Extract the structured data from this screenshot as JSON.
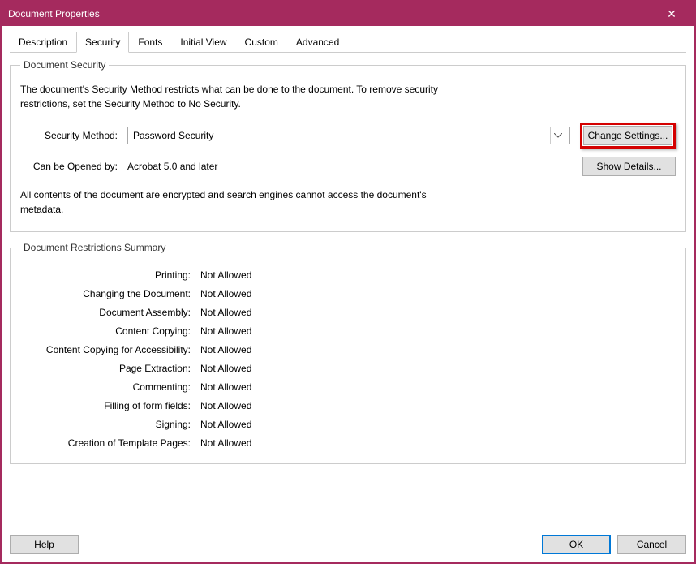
{
  "window": {
    "title": "Document Properties"
  },
  "tabs": {
    "description": "Description",
    "security": "Security",
    "fonts": "Fonts",
    "initial_view": "Initial View",
    "custom": "Custom",
    "advanced": "Advanced"
  },
  "doc_security": {
    "legend": "Document Security",
    "description": "The document's Security Method restricts what can be done to the document. To remove security restrictions, set the Security Method to No Security.",
    "method_label": "Security Method:",
    "method_value": "Password Security",
    "change_settings": "Change Settings...",
    "compat_label": "Can be Opened by:",
    "compat_value": "Acrobat 5.0 and later",
    "show_details": "Show Details...",
    "enc_note": "All contents of the document are encrypted and search engines cannot access the document's metadata."
  },
  "restrictions": {
    "legend": "Document Restrictions Summary",
    "items": [
      {
        "label": "Printing:",
        "value": "Not Allowed"
      },
      {
        "label": "Changing the Document:",
        "value": "Not Allowed"
      },
      {
        "label": "Document Assembly:",
        "value": "Not Allowed"
      },
      {
        "label": "Content Copying:",
        "value": "Not Allowed"
      },
      {
        "label": "Content Copying for Accessibility:",
        "value": "Not Allowed"
      },
      {
        "label": "Page Extraction:",
        "value": "Not Allowed"
      },
      {
        "label": "Commenting:",
        "value": "Not Allowed"
      },
      {
        "label": "Filling of form fields:",
        "value": "Not Allowed"
      },
      {
        "label": "Signing:",
        "value": "Not Allowed"
      },
      {
        "label": "Creation of Template Pages:",
        "value": "Not Allowed"
      }
    ]
  },
  "footer": {
    "help": "Help",
    "ok": "OK",
    "cancel": "Cancel"
  }
}
